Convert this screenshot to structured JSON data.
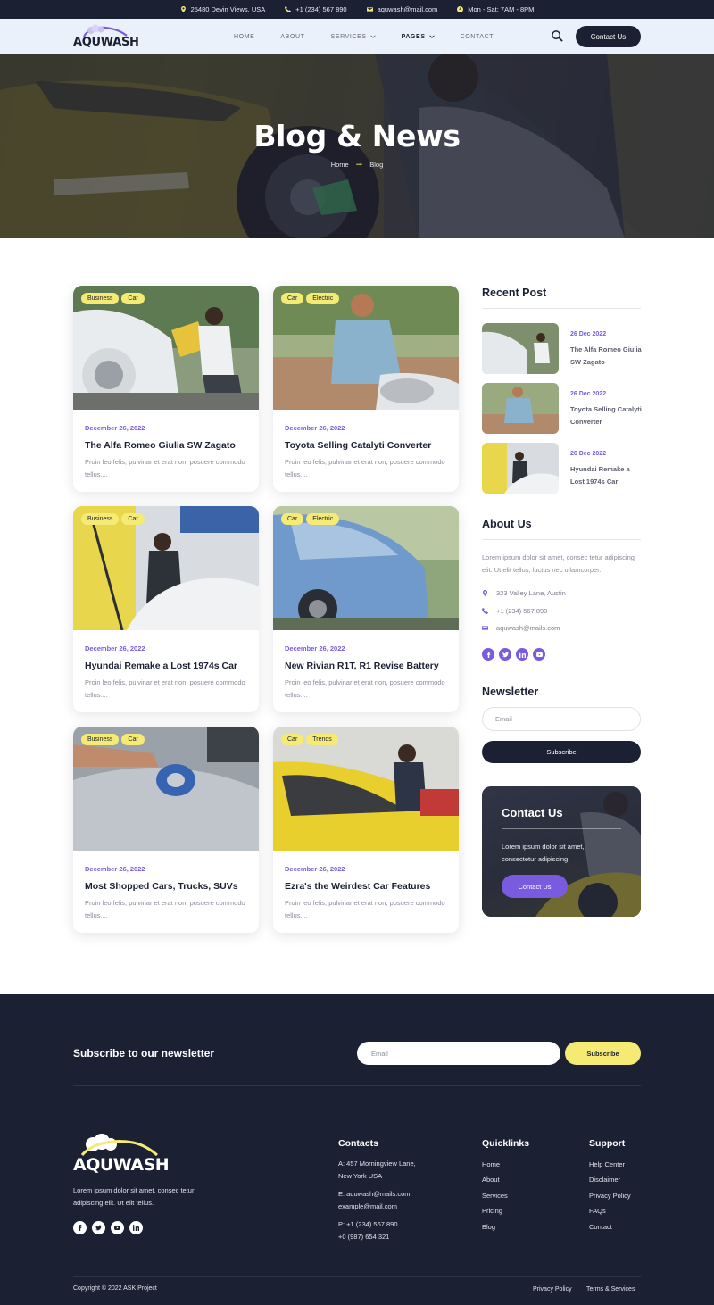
{
  "topbar": {
    "address": "25480 Devin Views, USA",
    "phone": "+1 (234) 567 890",
    "email": "aquwash@mail.com",
    "hours": "Mon - Sat: 7AM - 8PM"
  },
  "brand": {
    "name": "AQUWASH"
  },
  "nav": {
    "items": [
      "HOME",
      "ABOUT",
      "SERVICES",
      "PAGES",
      "CONTACT"
    ],
    "active": "PAGES",
    "cta": "Contact Us"
  },
  "hero": {
    "title": "Blog & News",
    "breadcrumb": [
      "Home",
      "Blog"
    ]
  },
  "posts": [
    {
      "tags": [
        "Business",
        "Car"
      ],
      "date": "December 26, 2022",
      "title": "The Alfa Romeo Giulia SW Zagato",
      "excerpt": "Proin leo felis, pulvinar et erat non, posuere commodo tellus...."
    },
    {
      "tags": [
        "Car",
        "Electric"
      ],
      "date": "December 26, 2022",
      "title": "Toyota Selling Catalyti Converter",
      "excerpt": "Proin leo felis, pulvinar et erat non, posuere commodo tellus...."
    },
    {
      "tags": [
        "Business",
        "Car"
      ],
      "date": "December 26, 2022",
      "title": "Hyundai Remake a Lost 1974s Car",
      "excerpt": "Proin leo felis, pulvinar et erat non, posuere commodo tellus...."
    },
    {
      "tags": [
        "Car",
        "Electric"
      ],
      "date": "December 26, 2022",
      "title": "New Rivian R1T, R1 Revise Battery",
      "excerpt": "Proin leo felis, pulvinar et erat non, posuere commodo tellus...."
    },
    {
      "tags": [
        "Business",
        "Car"
      ],
      "date": "December 26, 2022",
      "title": "Most Shopped Cars, Trucks, SUVs",
      "excerpt": "Proin leo felis, pulvinar et erat non, posuere commodo tellus...."
    },
    {
      "tags": [
        "Car",
        "Trends"
      ],
      "date": "December 26, 2022",
      "title": "Ezra's the Weirdest Car Features",
      "excerpt": "Proin leo felis, pulvinar et erat non, posuere commodo tellus...."
    }
  ],
  "sidebar": {
    "recent_heading": "Recent Post",
    "recent": [
      {
        "date": "26 Dec 2022",
        "title": "The Alfa Romeo Giulia SW Zagato"
      },
      {
        "date": "26 Dec 2022",
        "title": "Toyota Selling Catalyti Converter"
      },
      {
        "date": "26 Dec 2022",
        "title": "Hyundai Remake a Lost 1974s Car"
      }
    ],
    "about_heading": "About Us",
    "about_text": "Lorem ipsum dolor sit amet, consec tetur adipiscing elit. Ut elit tellus, luctus nec ullamcorper.",
    "address": "323 Valley Lane, Austin",
    "phone": "+1 (234) 567 890",
    "email": "aquwash@mails.com",
    "newsletter_heading": "Newsletter",
    "newsletter_placeholder": "Email",
    "newsletter_button": "Subscribe",
    "contact_card": {
      "heading": "Contact Us",
      "text": "Lorem ipsum dolor sit amet, consectetur adipiscing.",
      "button": "Contact Us"
    }
  },
  "footer": {
    "subscribe_heading": "Subscribe to our newsletter",
    "subscribe_placeholder": "Email",
    "subscribe_button": "Subscribe",
    "about_text": "Lorem ipsum dolor sit amet, consec tetur adipiscing elit. Ut elit tellus.",
    "contacts_heading": "Contacts",
    "address_line1": "A: 457 Morningview Lane,",
    "address_line2": "New York USA",
    "email_line1": "E: aquwash@mails.com",
    "email_line2": "example@mail.com",
    "phone_line1": "P: +1 (234) 567 890",
    "phone_line2": "+0 (987) 654 321",
    "quicklinks_heading": "Quicklinks",
    "quicklinks": [
      "Home",
      "About",
      "Services",
      "Pricing",
      "Blog"
    ],
    "support_heading": "Support",
    "support": [
      "Help Center",
      "Disclaimer",
      "Privacy Policy",
      "FAQs",
      "Contact"
    ],
    "copyright": "Copyright © 2022 ASK Project",
    "legal": [
      "Privacy Policy",
      "Terms & Services"
    ]
  },
  "colors": {
    "navy": "#1c2033",
    "accent_purple": "#7a5be0",
    "accent_yellow": "#f4ea74",
    "nav_bg": "#eaf1fb"
  },
  "icons": {
    "topbar": [
      "location-pin-icon",
      "phone-icon",
      "mail-icon",
      "clock-icon"
    ],
    "social": [
      "facebook-icon",
      "twitter-icon",
      "linkedin-icon",
      "youtube-icon"
    ]
  }
}
